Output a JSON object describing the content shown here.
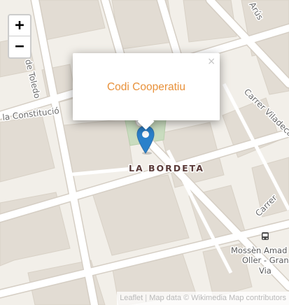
{
  "map": {
    "zoom_in_label": "+",
    "zoom_out_label": "−",
    "street_labels": {
      "de_toledo": "de Toledo",
      "la_constitucio": "la Constitució",
      "carrer_viladecans": "Carrer Viladeca",
      "carrer_bottom_right": "Carrer",
      "arus": "Arús"
    },
    "district_label": "LA BORDETA",
    "poi": {
      "icon": "bus-stop-icon",
      "line1": "Mossèn Amad",
      "line2": "Oller - Gran",
      "line3": "Via"
    },
    "marker": {
      "icon": "map-pin-icon",
      "color": "#2a81cb"
    }
  },
  "popup": {
    "content": "Codi Cooperatiu",
    "close_label": "×",
    "text_color": "#e8913a"
  },
  "attribution": {
    "leaflet": "Leaflet",
    "separator": "|",
    "map_data": "Map data © Wikimedia Map contributors"
  }
}
